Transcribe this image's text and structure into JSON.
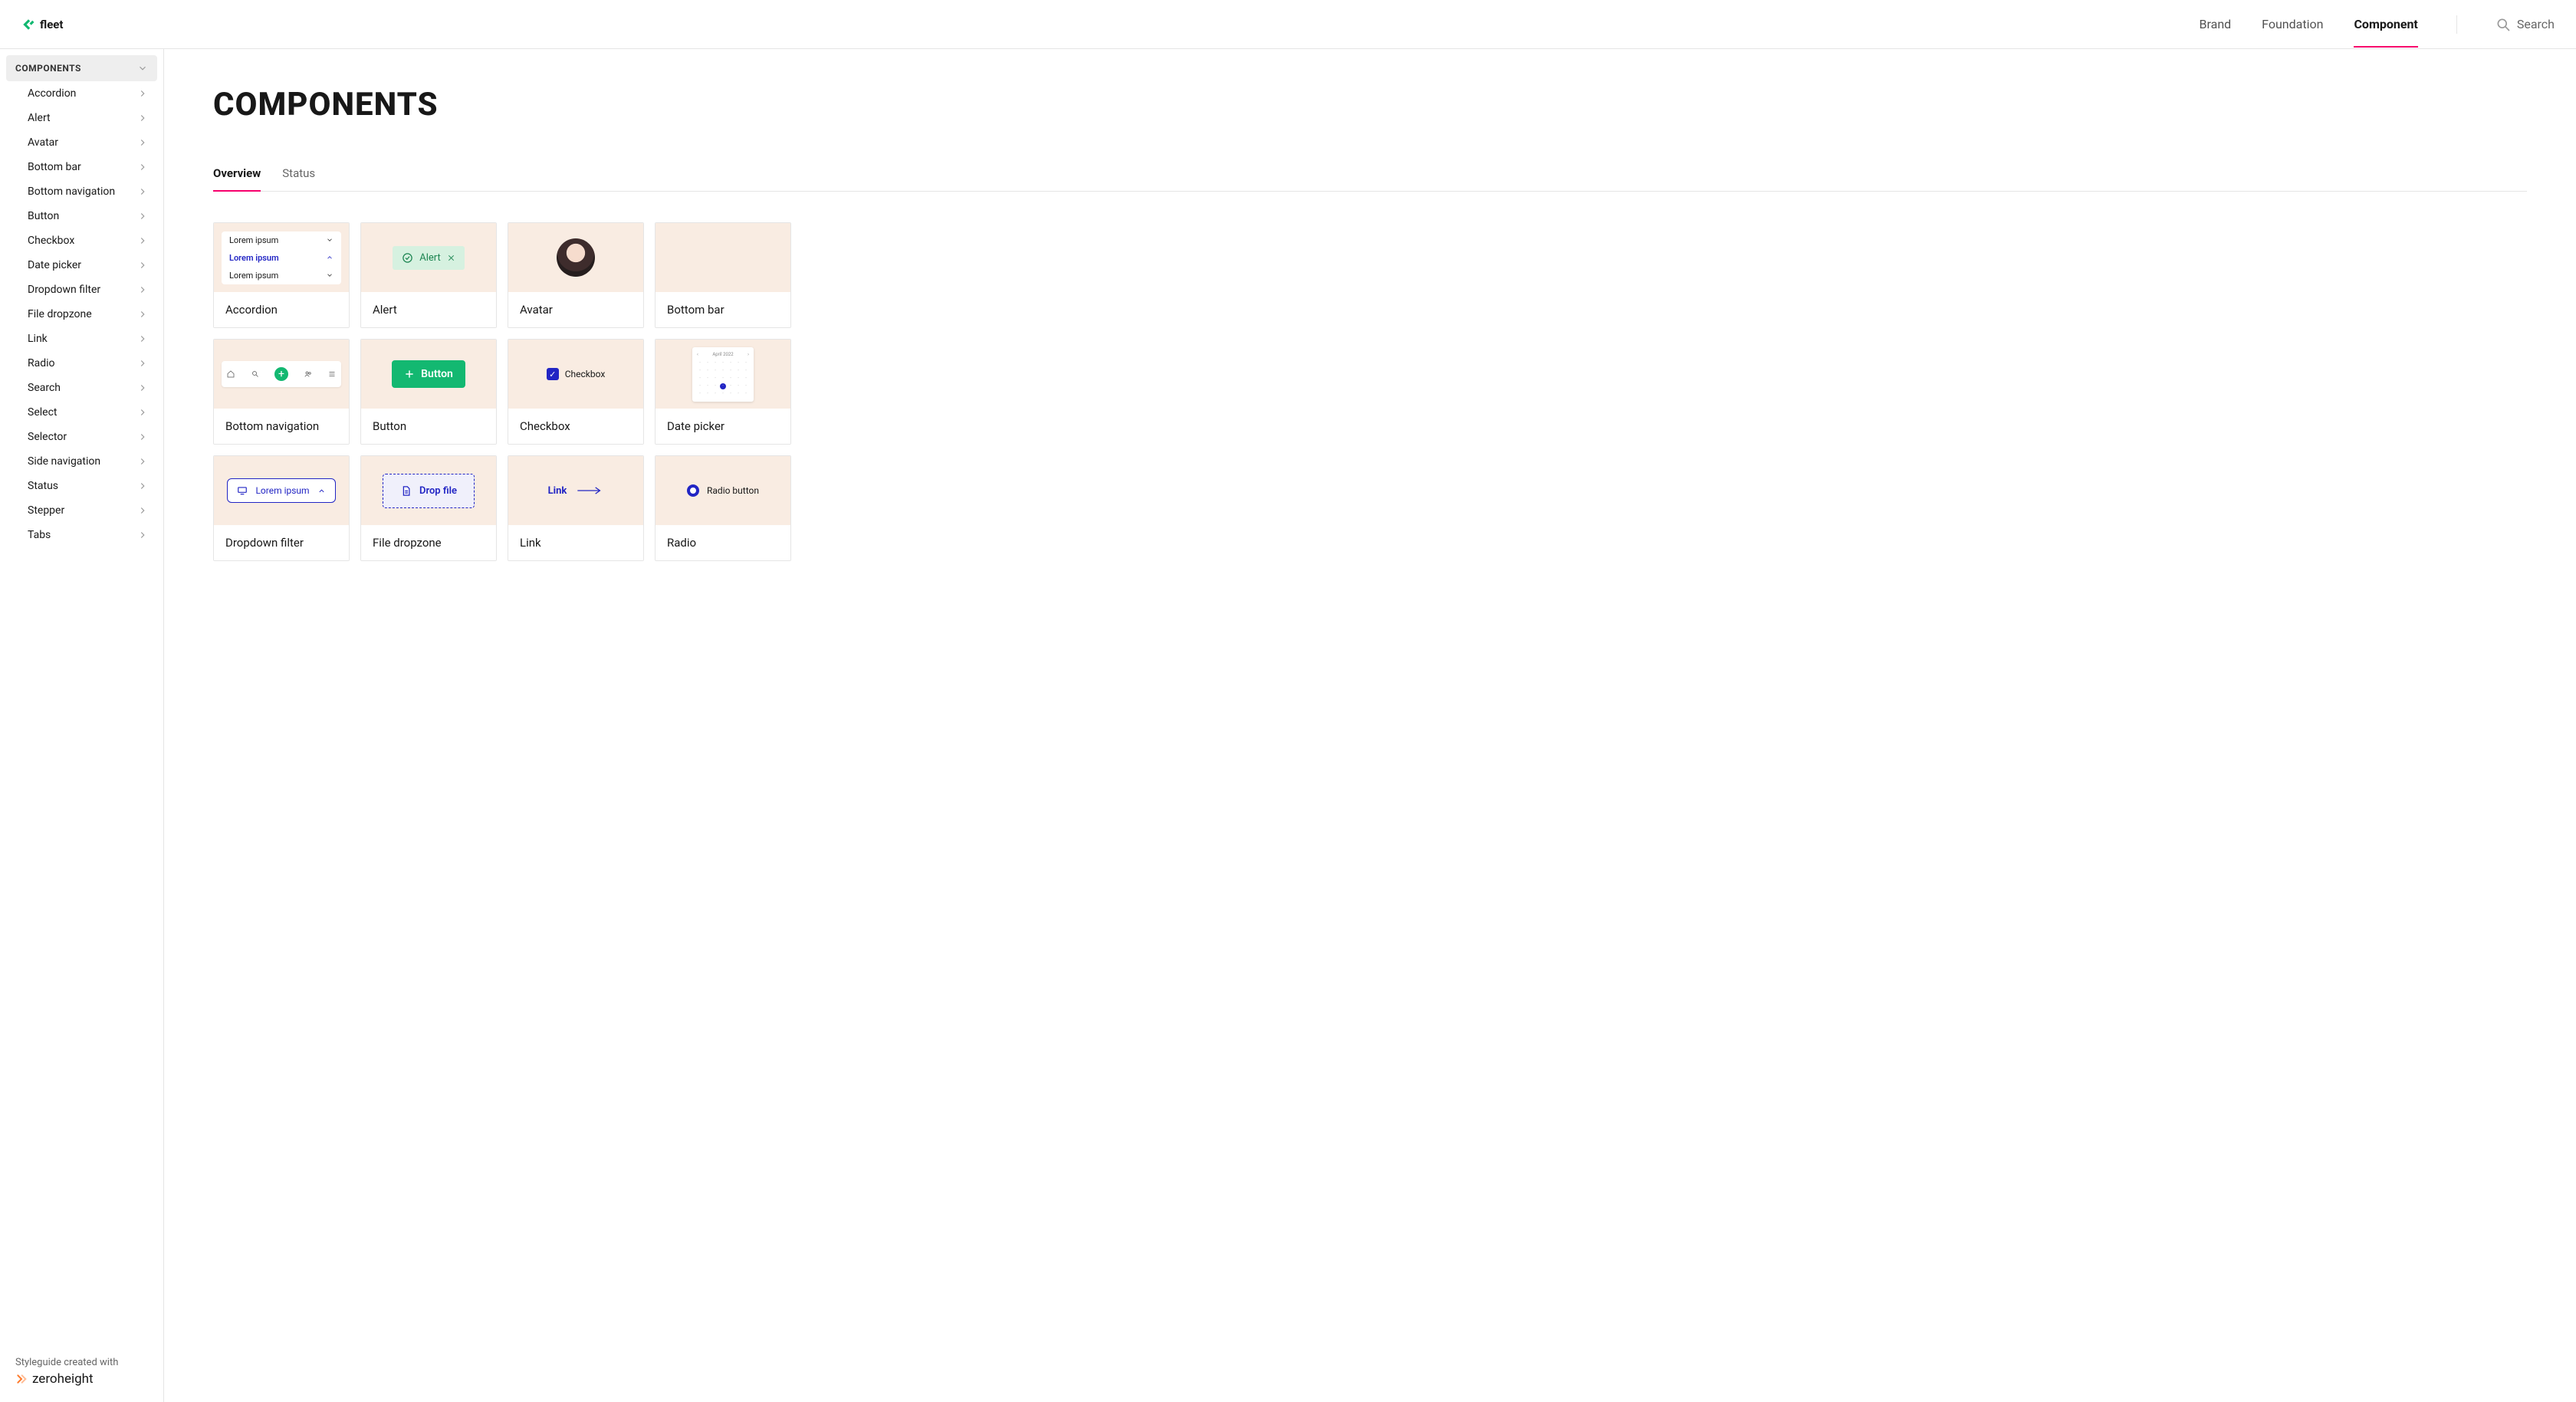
{
  "brand": {
    "name": "fleet"
  },
  "header": {
    "nav": [
      {
        "label": "Brand",
        "active": false
      },
      {
        "label": "Foundation",
        "active": false
      },
      {
        "label": "Component",
        "active": true
      }
    ],
    "search_label": "Search"
  },
  "sidebar": {
    "group_title": "COMPONENTS",
    "items": [
      "Accordion",
      "Alert",
      "Avatar",
      "Bottom bar",
      "Bottom navigation",
      "Button",
      "Checkbox",
      "Date picker",
      "Dropdown filter",
      "File dropzone",
      "Link",
      "Radio",
      "Search",
      "Select",
      "Selector",
      "Side navigation",
      "Status",
      "Stepper",
      "Tabs"
    ],
    "footer_line": "Styleguide created with",
    "footer_brand": "zeroheight"
  },
  "page": {
    "title": "COMPONENTS",
    "tabs": [
      {
        "label": "Overview",
        "active": true
      },
      {
        "label": "Status",
        "active": false
      }
    ]
  },
  "cards": [
    {
      "key": "accordion",
      "label": "Accordion"
    },
    {
      "key": "alert",
      "label": "Alert"
    },
    {
      "key": "avatar",
      "label": "Avatar"
    },
    {
      "key": "bottom-bar",
      "label": "Bottom bar"
    },
    {
      "key": "bottom-navigation",
      "label": "Bottom navigation"
    },
    {
      "key": "button",
      "label": "Button"
    },
    {
      "key": "checkbox",
      "label": "Checkbox"
    },
    {
      "key": "date-picker",
      "label": "Date picker"
    },
    {
      "key": "dropdown-filter",
      "label": "Dropdown filter"
    },
    {
      "key": "file-dropzone",
      "label": "File dropzone"
    },
    {
      "key": "link",
      "label": "Link"
    },
    {
      "key": "radio",
      "label": "Radio"
    }
  ],
  "previews": {
    "accordion_rows": [
      "Lorem ipsum",
      "Lorem ipsum",
      "Lorem ipsum"
    ],
    "alert_text": "Alert",
    "button_text": "Button",
    "checkbox_text": "Checkbox",
    "dropdown_text": "Lorem ipsum",
    "dropzone_text": "Drop file",
    "link_text": "Link",
    "radio_text": "Radio button",
    "calendar": {
      "month": "April",
      "year": "2022"
    }
  }
}
